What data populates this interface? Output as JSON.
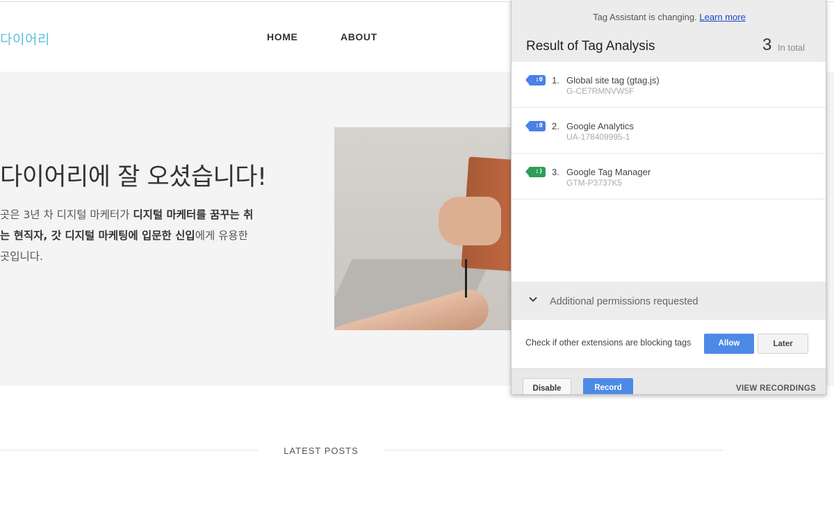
{
  "site": {
    "logo": "다이어리",
    "nav": {
      "home": "HOME",
      "about": "ABOUT"
    },
    "hero": {
      "title": "다이어리에 잘 오셨습니다!",
      "line1_normal": "곳은 3년 차 디지털 마케터가 ",
      "line1_bold": "디지털 마케터를 꿈꾸는 취",
      "line2_bold": "는 현직자, 갓 디지털 마케팅에 입문한 신입",
      "line2_normal": "에게 유용한",
      "line3_normal": " 곳입니다."
    },
    "latest_posts": "LATEST POSTS"
  },
  "extension": {
    "notice_text": "Tag Assistant is changing.",
    "notice_link": "Learn more",
    "result_title": "Result of Tag Analysis",
    "total_count": "3",
    "total_label": "In total",
    "tags": [
      {
        "num": "1.",
        "name": "Global site tag (gtag.js)",
        "id": "G-CE7RMNVW5F",
        "icon_text": ":0",
        "icon_color": "#4a80e8"
      },
      {
        "num": "2.",
        "name": "Google Analytics",
        "id": "UA-178409995-1",
        "icon_text": ":0",
        "icon_color": "#4a80e8"
      },
      {
        "num": "3.",
        "name": "Google Tag Manager",
        "id": "GTM-P3737K5",
        "icon_text": ":)",
        "icon_color": "#2f9e5a"
      }
    ],
    "permissions_label": "Additional permissions requested",
    "check_text": "Check if other extensions are blocking tags",
    "allow_label": "Allow",
    "later_label": "Later",
    "disable_label": "Disable",
    "record_label": "Record",
    "view_recordings_label": "VIEW RECORDINGS"
  }
}
